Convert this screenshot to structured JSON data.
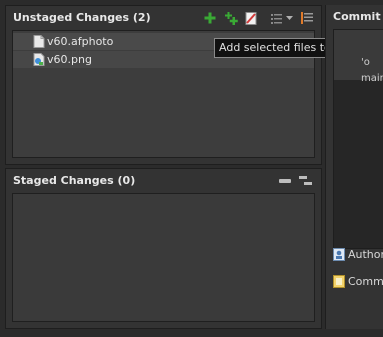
{
  "unstaged": {
    "title": "Unstaged Changes (2)",
    "toolbar": {
      "add_icon": "add-icon",
      "add_all_icon": "add-all-icon",
      "ignore_icon": "ignore-icon",
      "presentation_icon": "list-icon",
      "menu_icon": "dropdown-arrow-icon",
      "sort_icon": "sort-icon"
    },
    "files": [
      {
        "name": "v60.afphoto",
        "icon": "file-icon"
      },
      {
        "name": "v60.png",
        "icon": "image-file-icon"
      }
    ]
  },
  "tooltip": {
    "text": "Add selected files to the index"
  },
  "staged": {
    "title": "Staged Changes (0)",
    "toolbar": {
      "remove_icon": "remove-icon",
      "remove_all_icon": "remove-all-icon"
    }
  },
  "commit": {
    "title": "Commit M",
    "message_fragments": [
      "'o",
      "main"
    ],
    "author_label": "Author",
    "committer_label": "Commi"
  },
  "colors": {
    "add_green": "#3aaa35",
    "background": "#2b2b2b",
    "panel": "#333333",
    "list_bg": "#3d3d3d"
  }
}
